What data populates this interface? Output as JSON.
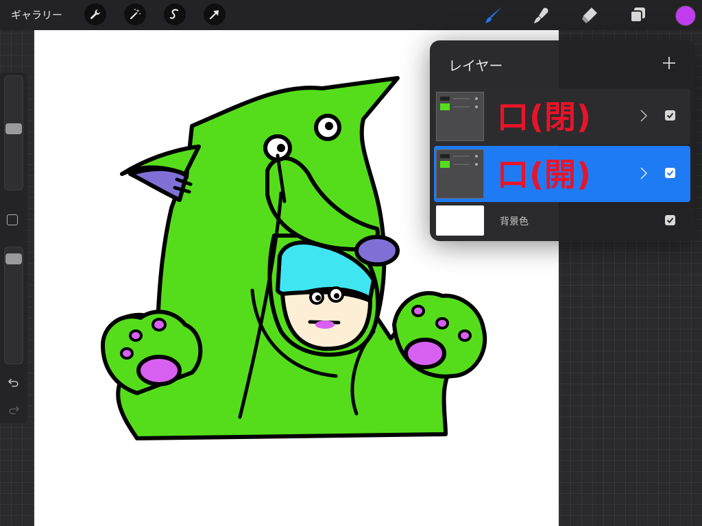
{
  "toolbar": {
    "gallery_label": "ギャラリー",
    "left_tools": [
      "wrench-icon",
      "magic-wand-icon",
      "selection-icon",
      "transform-arrow-icon"
    ],
    "right_tools": [
      "brush-icon",
      "smudge-icon",
      "eraser-icon",
      "layers-icon"
    ],
    "active_tool": "brush-icon",
    "current_color": "#c13ef0",
    "accent_color": "#1e7bf3"
  },
  "sidebar": {
    "brush_size": 0.55,
    "opacity": 0.95
  },
  "layers_panel": {
    "title": "レイヤー",
    "add_label": "+",
    "layers": [
      {
        "name": "口(閉)",
        "visible": true,
        "selected": false
      },
      {
        "name": "口(開)",
        "visible": true,
        "selected": true
      }
    ],
    "background": {
      "name": "背景色",
      "color": "#ffffff",
      "visible": true
    }
  },
  "colors": {
    "body_green": "#55dd1b",
    "ear_purple": "#8070d6",
    "hair_cyan": "#3fe6f2",
    "face_skin": "#fdefd6",
    "paw_pink": "#d860f0",
    "layer_name_red": "#e8142a"
  }
}
